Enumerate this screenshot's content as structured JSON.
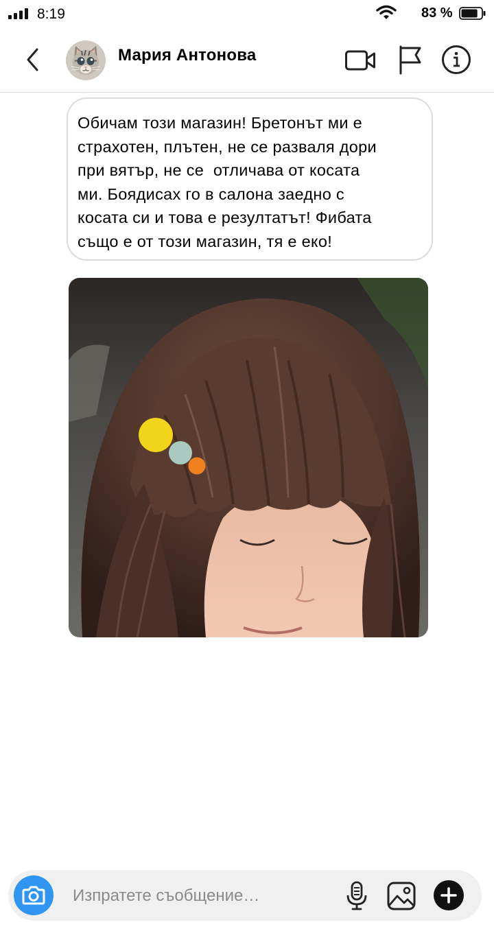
{
  "status_bar": {
    "time": "8:19",
    "battery_percent": "83 %",
    "battery_level": 0.83,
    "icons": [
      "cellular-signal-icon",
      "wifi-icon",
      "battery-icon"
    ]
  },
  "header": {
    "contact_name": "Мария Антонова",
    "icons": [
      "back-chevron-icon",
      "kitten-avatar",
      "video-call-icon",
      "flag-icon",
      "info-icon"
    ]
  },
  "message": {
    "lines": [
      "Обичам този магазин! Бретонът ми е",
      "страхотен, плътен, не се разваля дори",
      "при вятър, не се  отличава от косата",
      "ми. Боядисах го в салона заедно с",
      "косата си и това е резултатът! Фибата",
      "също е от този магазин, тя е еко!"
    ]
  },
  "photo": {
    "subject": "woman-with-bangs-and-hair-clip",
    "clip_colors": [
      "#f2d51a",
      "#a9c9c1",
      "#f0811f"
    ]
  },
  "composer": {
    "placeholder": "Изпратете съобщение…",
    "value": "",
    "icons": [
      "camera-icon",
      "microphone-icon",
      "gallery-icon",
      "plus-icon"
    ]
  },
  "colors": {
    "accent": "#2f95f1",
    "bubble_border": "#dcdcdc",
    "composer_bg": "#f0f0f0"
  }
}
